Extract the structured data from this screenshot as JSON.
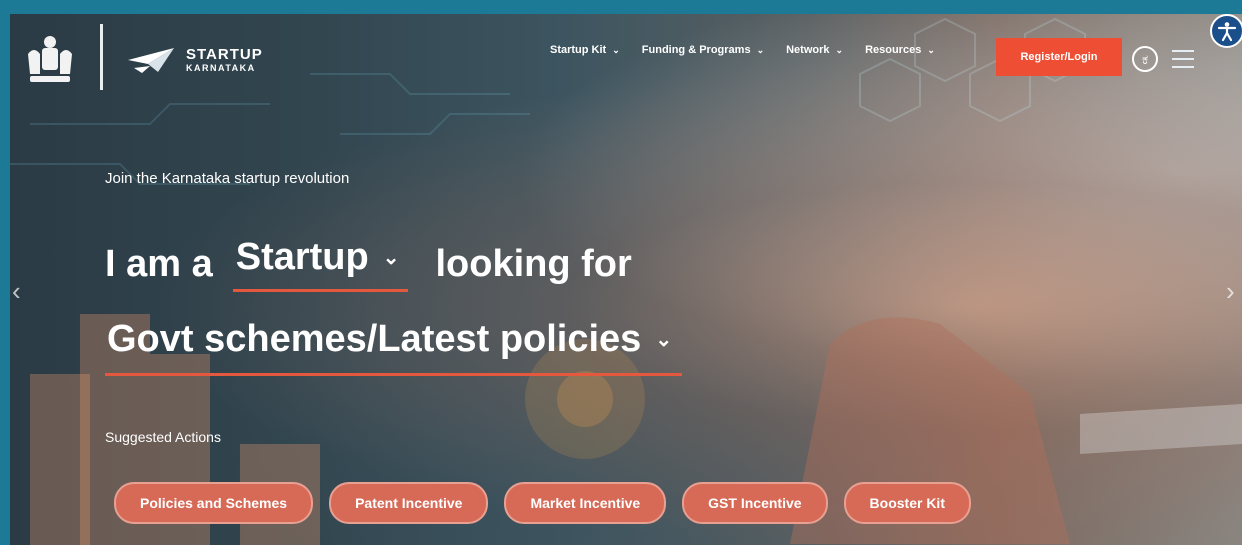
{
  "brand": {
    "line1": "STARTUP",
    "line2": "KARNATAKA"
  },
  "nav": {
    "items": [
      {
        "label": "Startup Kit"
      },
      {
        "label": "Funding & Programs"
      },
      {
        "label": "Network"
      },
      {
        "label": "Resources"
      }
    ],
    "register_label": "Register/Login",
    "language_glyph": "ಕ"
  },
  "hero": {
    "tagline": "Join the Karnataka startup revolution",
    "prefix": "I am a",
    "role": "Startup",
    "suffix": "looking for",
    "need": "Govt schemes/Latest policies",
    "suggested_heading": "Suggested Actions",
    "actions": [
      {
        "label": "Policies and Schemes"
      },
      {
        "label": "Patent Incentive"
      },
      {
        "label": "Market Incentive"
      },
      {
        "label": "GST Incentive"
      },
      {
        "label": "Booster Kit"
      }
    ]
  },
  "colors": {
    "accent": "#ee4e34",
    "border": "#1c7a97",
    "underline": "#e4583d"
  }
}
